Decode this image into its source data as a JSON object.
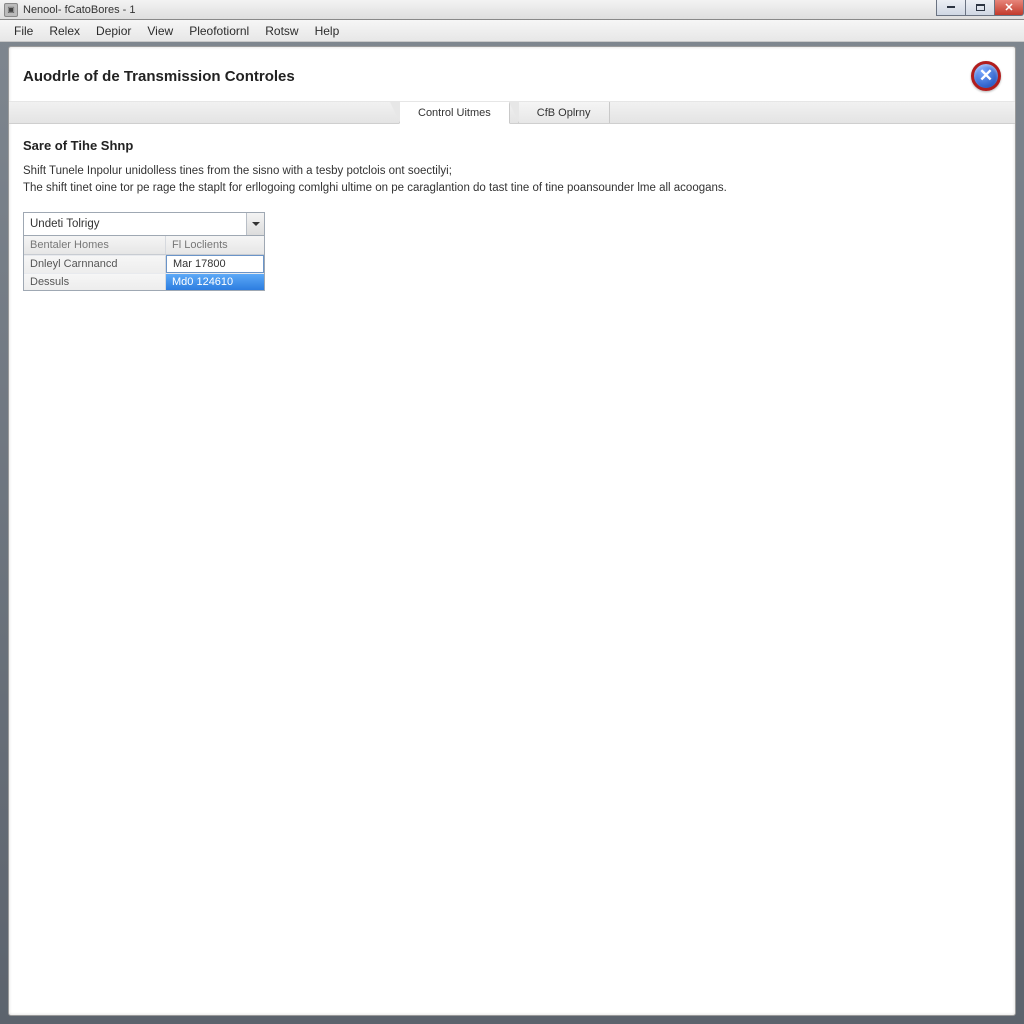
{
  "window": {
    "title": "Nenool- fCatoBores - 1"
  },
  "menu": {
    "items": [
      "File",
      "Relex",
      "Depior",
      "View",
      "Pleofotiornl",
      "Rotsw",
      "Help"
    ]
  },
  "header": {
    "title": "Auodrle of de Transmission Controles",
    "help_glyph": "✕"
  },
  "tabs": [
    {
      "label": "Control Uitmes",
      "active": true
    },
    {
      "label": "CfB Oplrny",
      "active": false
    }
  ],
  "section": {
    "heading": "Sare of Tihe Shnp",
    "line1": "Shift Tunele Inpolur unidolless tines from the sisno with a tesby potclois ont soectilyi;",
    "line2": "The shift tinet oine tor pe rage the staplt for erllogoing comlghi ultime on pe caraglantion do tast tine of tine poansounder lme all acoogans."
  },
  "combo": {
    "value": "Undeti Tolrigy",
    "columns": {
      "c1": "Bentaler Homes",
      "c2": "Fl Loclients"
    },
    "rows": [
      {
        "label": "Dnleyl Carnnancd",
        "value": "Mar 17800",
        "selected": false
      },
      {
        "label": "Dessuls",
        "value": "Md0 124610",
        "selected": true
      }
    ]
  }
}
